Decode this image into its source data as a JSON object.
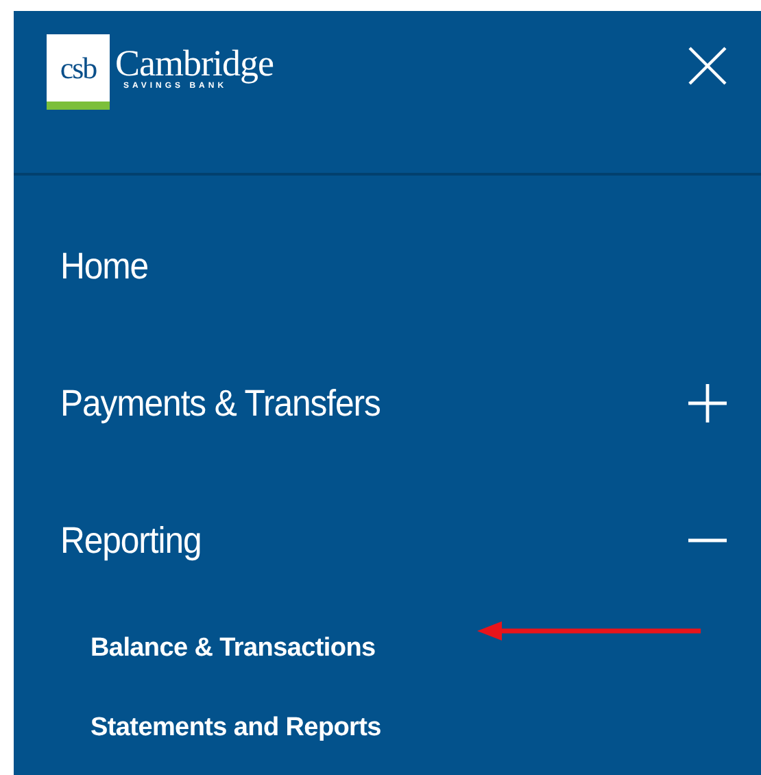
{
  "header": {
    "logo": {
      "mark": "csb",
      "name": "Cambridge",
      "tagline": "SAVINGS BANK"
    }
  },
  "menu": [
    {
      "label": "Home"
    },
    {
      "label": "Payments & Transfers",
      "expanded": false
    },
    {
      "label": "Reporting",
      "expanded": true,
      "children": [
        {
          "label": "Balance & Transactions"
        },
        {
          "label": "Statements and Reports"
        }
      ]
    }
  ]
}
